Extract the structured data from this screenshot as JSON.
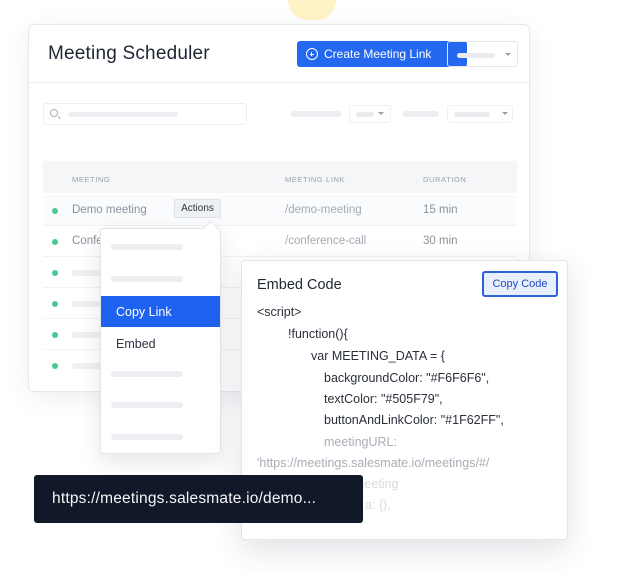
{
  "app": {
    "title": "Meeting Scheduler"
  },
  "header": {
    "create_button_label": "Create Meeting Link"
  },
  "table": {
    "columns": [
      "MEETING",
      "MEETING LINK",
      "DURATION"
    ],
    "rows": [
      {
        "name": "Demo meeting",
        "link": "/demo-meeting",
        "duration": "15 min",
        "status_color": "#4cc790"
      },
      {
        "name": "Conference call",
        "link": "/conference-call",
        "duration": "30 min",
        "status_color": "#4cc790"
      }
    ],
    "actions_label": "Actions"
  },
  "actions_menu": {
    "items": [
      {
        "label": "Copy Link",
        "active": true
      },
      {
        "label": "Embed",
        "active": false
      }
    ]
  },
  "embed_panel": {
    "title": "Embed Code",
    "copy_button_label": "Copy Code",
    "code_lines": [
      "<script>",
      "!function(){",
      "var MEETING_DATA = {",
      "backgroundColor: \"#F6F6F6\",",
      "textColor: \"#505F79\",",
      "buttonAndLinkColor: \"#1F62FF\",",
      "meetingURL:",
      "'https://meetings.salesmate.io/meetings/#/",
      "meeting",
      "a: {},"
    ]
  },
  "url_tooltip": {
    "text": "https://meetings.salesmate.io/demo..."
  },
  "colors": {
    "accent": "#2568f0",
    "active_menu": "#1f62ef",
    "status_green": "#4cc790",
    "tooltip_bg": "#111827"
  },
  "icons": {
    "create_button": "plus-circle-icon",
    "search": "search-icon",
    "dropdown": "chevron-down-icon"
  }
}
